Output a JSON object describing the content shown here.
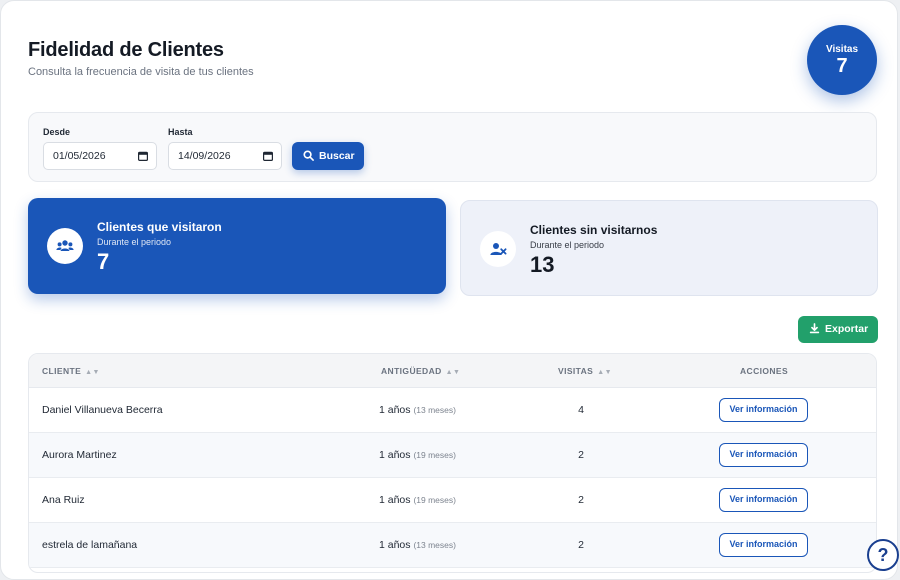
{
  "header": {
    "title": "Fidelidad de Clientes",
    "subtitle": "Consulta la frecuencia de visita de tus clientes"
  },
  "visits_badge": {
    "label": "Visitas",
    "value": "7"
  },
  "filters": {
    "from_label": "Desde",
    "from_value": "01/05/2026",
    "to_label": "Hasta",
    "to_value": "14/09/2026",
    "search_label": "Buscar"
  },
  "cards": {
    "visited": {
      "title": "Clientes que visitaron",
      "subtitle": "Durante el periodo",
      "value": "7"
    },
    "not_visited": {
      "title": "Clientes sin visitarnos",
      "subtitle": "Durante el periodo",
      "value": "13"
    }
  },
  "export_label": "Exportar",
  "table": {
    "headers": {
      "client": "CLIENTE",
      "seniority": "ANTIGÜEDAD",
      "visits": "VISITAS",
      "actions": "ACCIONES"
    },
    "action_label": "Ver información",
    "rows": [
      {
        "name": "Daniel Villanueva Becerra",
        "years": "1 años",
        "months": "(13 meses)",
        "visits": "4"
      },
      {
        "name": "Aurora Martinez",
        "years": "1 años",
        "months": "(19 meses)",
        "visits": "2"
      },
      {
        "name": "Ana Ruiz",
        "years": "1 años",
        "months": "(19 meses)",
        "visits": "2"
      },
      {
        "name": "estrela de lamañana",
        "years": "1 años",
        "months": "(13 meses)",
        "visits": "2"
      }
    ]
  },
  "help_label": "?",
  "colors": {
    "primary": "#1a56b8",
    "success": "#22a06b",
    "card_light": "#eef1f9"
  },
  "icons": {
    "search": "search-icon",
    "users": "users-group-icon",
    "user_x": "user-x-icon",
    "download": "download-icon",
    "calendar": "calendar-icon",
    "sort": "sort-icon",
    "help": "question-icon"
  }
}
